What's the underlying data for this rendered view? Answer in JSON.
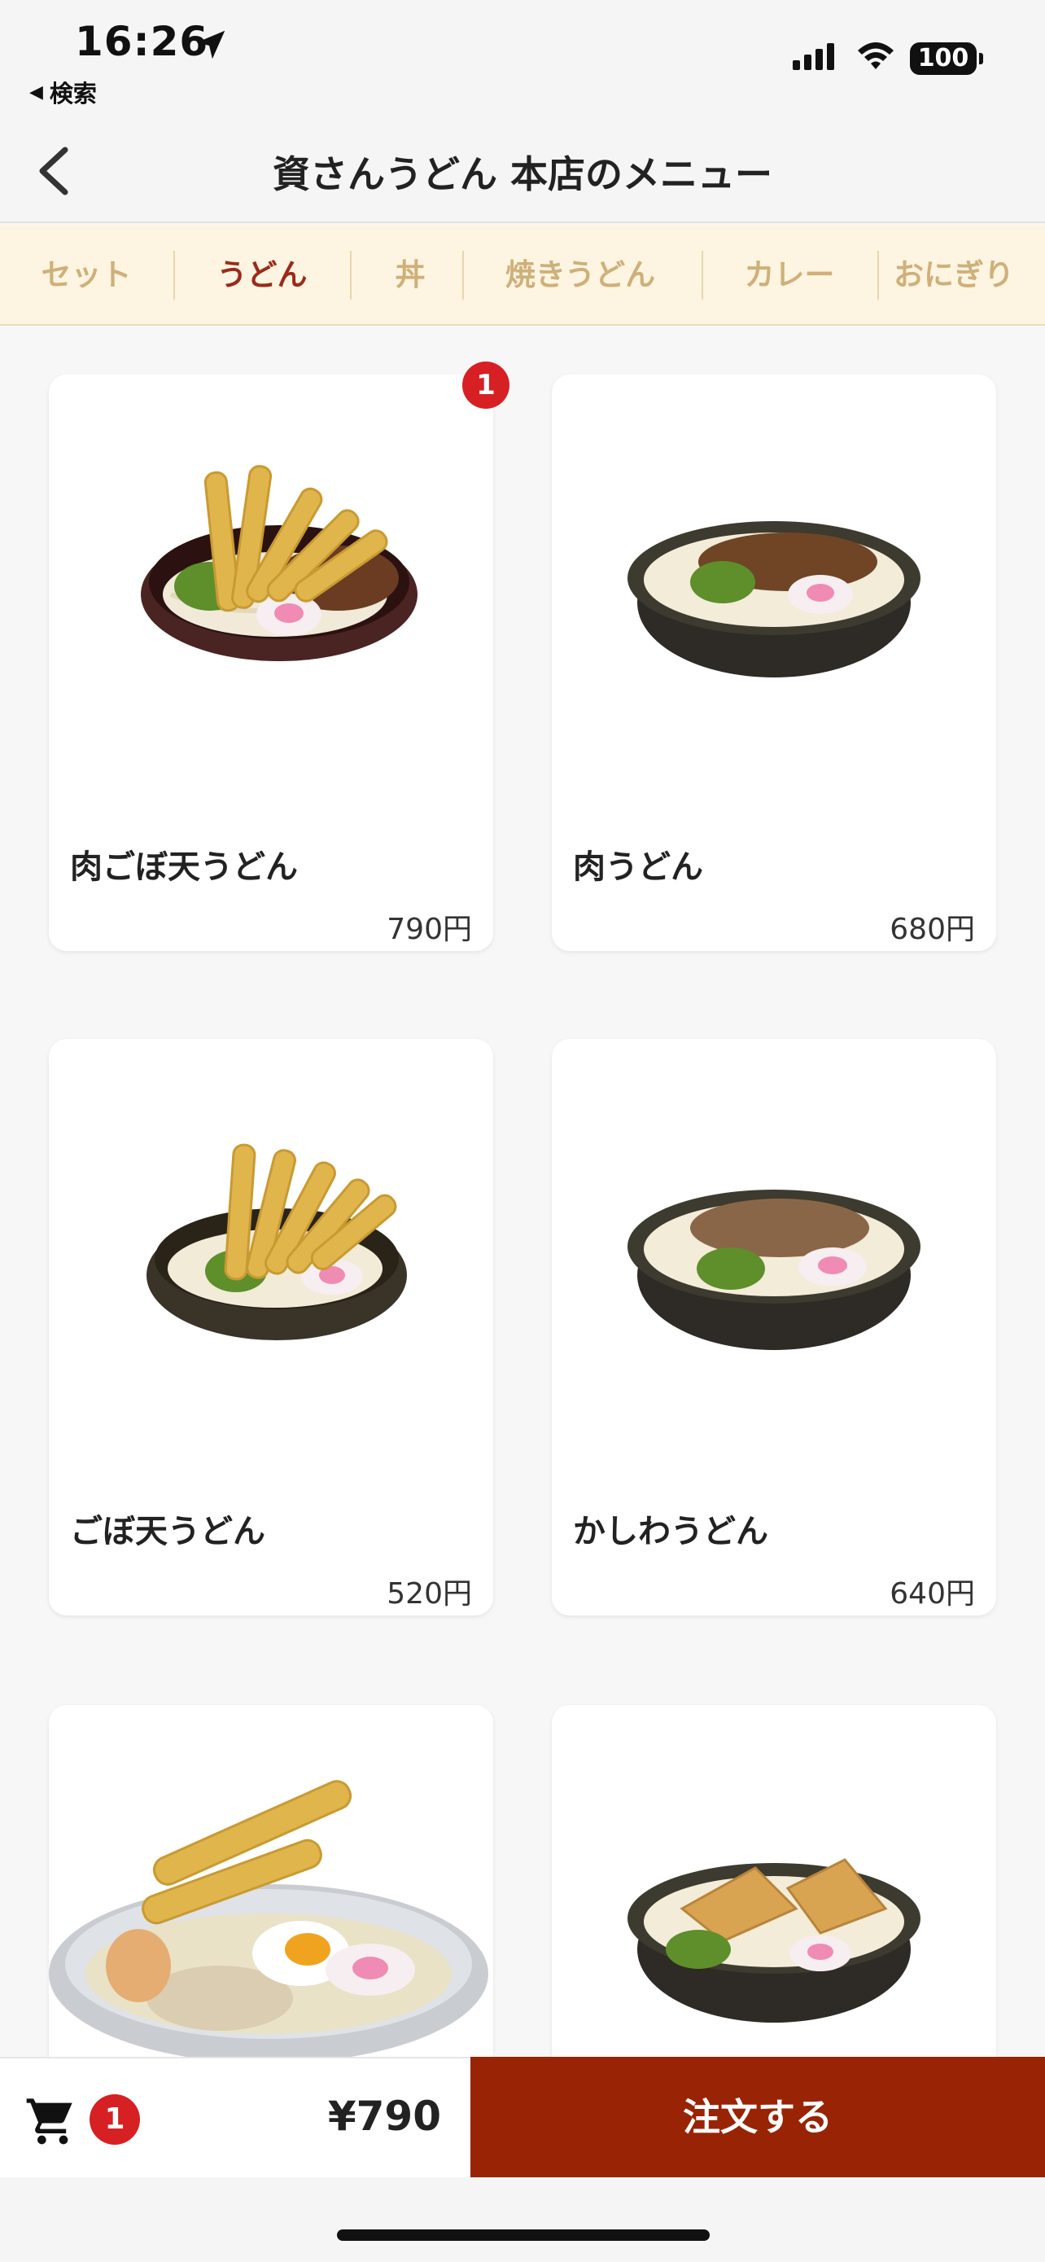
{
  "status_bar": {
    "time": "16:26",
    "back_app": "検索",
    "battery": "100",
    "icons": [
      "location-arrow-icon",
      "cellular-signal-icon",
      "wifi-icon",
      "battery-icon"
    ]
  },
  "nav": {
    "title": "資さんうどん 本店のメニュー",
    "back_icon": "chevron-left-icon"
  },
  "categories": [
    {
      "label": "セット",
      "active": false
    },
    {
      "label": "うどん",
      "active": true
    },
    {
      "label": "丼",
      "active": false
    },
    {
      "label": "焼きうどん",
      "active": false
    },
    {
      "label": "カレー",
      "active": false
    },
    {
      "label": "おにぎり",
      "active": false
    }
  ],
  "menu_items": [
    {
      "name": "肉ごぼ天うどん",
      "price": "790円",
      "count_badge": "1"
    },
    {
      "name": "肉うどん",
      "price": "680円"
    },
    {
      "name": "ごぼ天うどん",
      "price": "520円"
    },
    {
      "name": "かしわうどん",
      "price": "640円"
    },
    {
      "name": "",
      "price": ""
    },
    {
      "name": "",
      "price": ""
    }
  ],
  "cart": {
    "icon": "shopping-cart-icon",
    "count": "1",
    "total": "¥790",
    "order_label": "注文する"
  },
  "colors": {
    "accent": "#982405",
    "active_tab": "#9b2b1b",
    "inactive_tab": "#cfb07a",
    "badge": "#d62024",
    "category_bar": "#fdf5e1"
  }
}
